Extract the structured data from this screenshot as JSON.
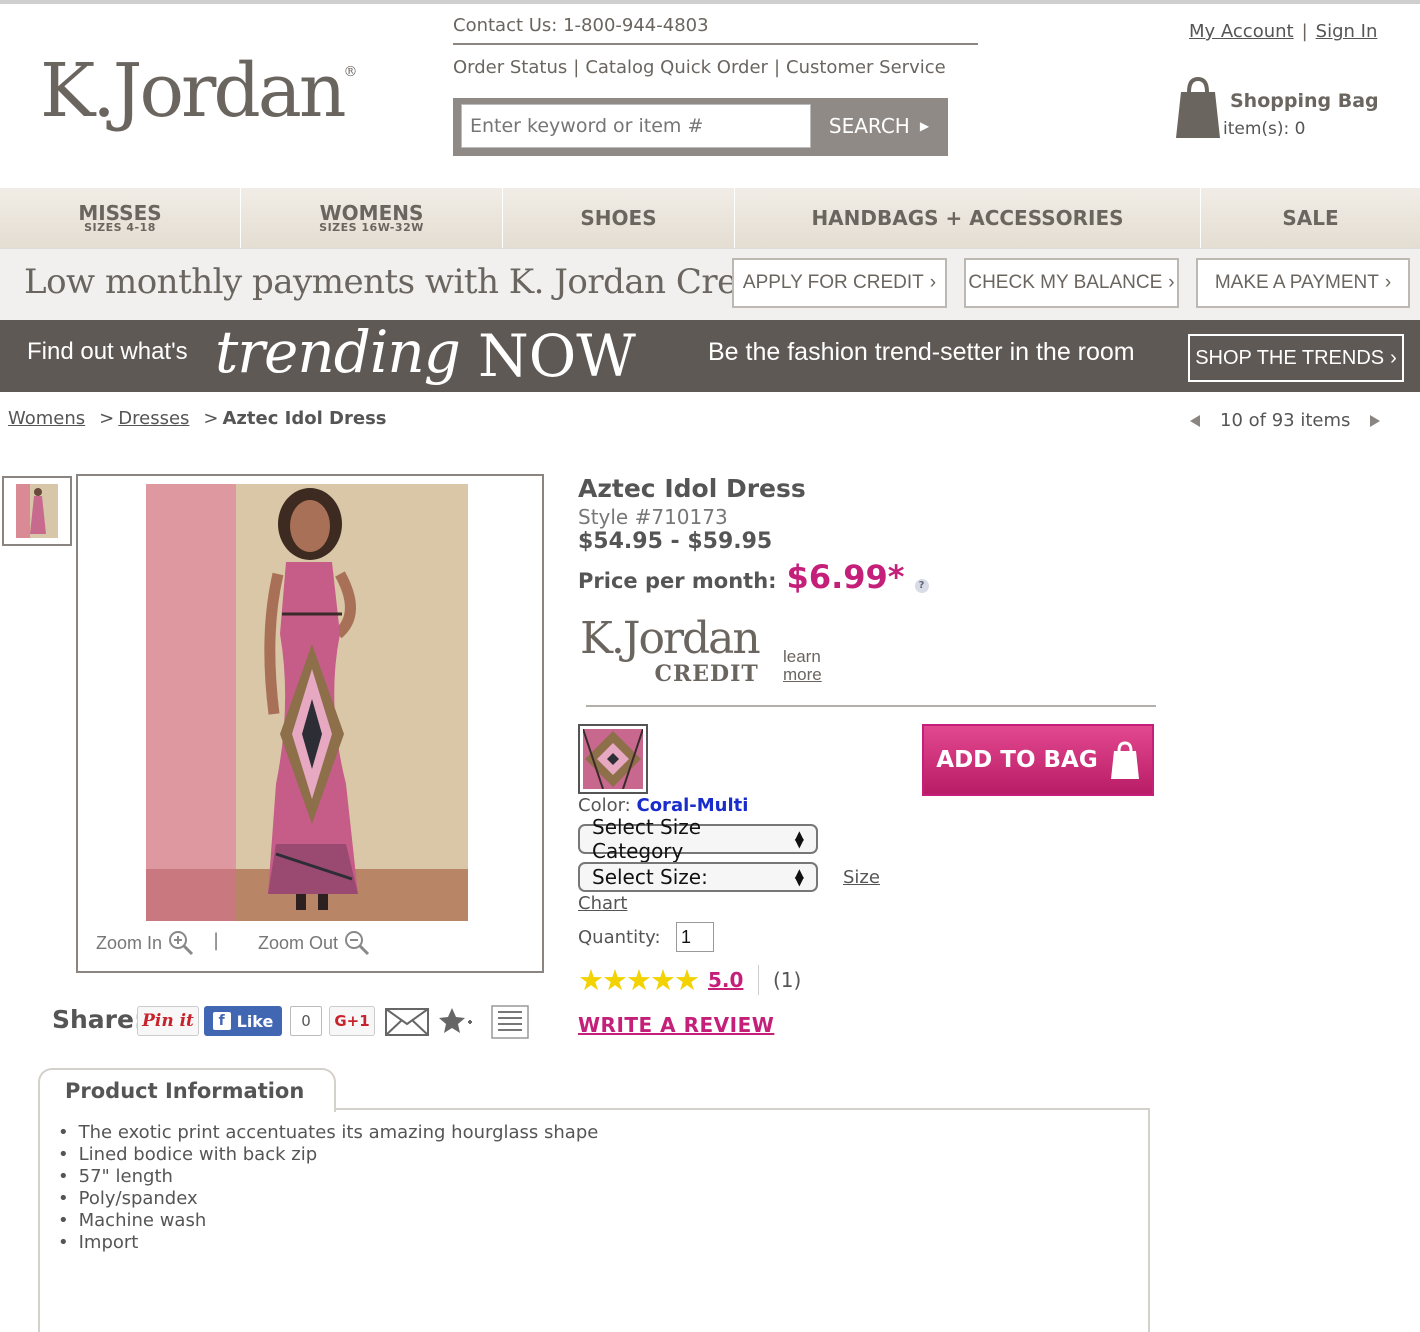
{
  "header": {
    "logo_text": "K.Jordan",
    "logo_mark": "®",
    "contact": "Contact Us: 1-800-944-4803",
    "links": [
      "Order Status",
      "Catalog Quick Order",
      "Customer Service"
    ],
    "search": {
      "placeholder": "Enter keyword or item #",
      "button": "SEARCH"
    },
    "account": {
      "my_account": "My Account",
      "sign_in": "Sign In"
    },
    "bag": {
      "title": "Shopping Bag",
      "count": "item(s): 0"
    }
  },
  "nav": [
    {
      "label": "MISSES",
      "sub": "SIZES 4-18"
    },
    {
      "label": "WOMENS",
      "sub": "SIZES 16W-32W"
    },
    {
      "label": "SHOES",
      "sub": ""
    },
    {
      "label": "HANDBAGS + ACCESSORIES",
      "sub": ""
    },
    {
      "label": "SALE",
      "sub": ""
    }
  ],
  "credit_bar": {
    "text": "Low monthly payments with K. Jordan Credit",
    "apply": "APPLY FOR CREDIT",
    "balance": "CHECK MY BALANCE",
    "payment": "MAKE A PAYMENT"
  },
  "trending": {
    "prefix": "Find out what's",
    "word": "trending",
    "now": "NOW",
    "tagline": "Be the fashion trend-setter in the room",
    "button": "SHOP THE TRENDS"
  },
  "breadcrumb": {
    "level1": "Womens",
    "level2": "Dresses",
    "current": "Aztec Idol Dress",
    "sep": ">"
  },
  "pager": "10 of 93 items",
  "gallery": {
    "zoom_in": "Zoom In",
    "zoom_out": "Zoom Out",
    "sep": "|"
  },
  "share": {
    "label": "Share:",
    "pin": "Pin it",
    "like": "Like",
    "like_count": "0",
    "gplus": "G+1"
  },
  "product": {
    "title": "Aztec Idol Dress",
    "style": "Style #710173",
    "price": "$54.95 - $59.95",
    "per_month_label": "Price per month:",
    "per_month": "$6.99*",
    "help": "?",
    "credit_logo": "K.Jordan",
    "credit_logo_sub": "CREDIT",
    "learn": "learn",
    "more": "more",
    "add_to_bag": "ADD TO BAG",
    "color_label": "Color:",
    "color_value": "Coral-Multi",
    "size_category": "Select Size Category",
    "size": "Select Size:",
    "size_chart_1": "Size",
    "size_chart_2": "Chart",
    "quantity_label": "Quantity:",
    "quantity": "1",
    "stars": "★★★★★",
    "rating": "5.0",
    "review_count": "(1)",
    "write_review": "WRITE A REVIEW"
  },
  "info": {
    "tab": "Product Information",
    "bullets": [
      "The exotic print accentuates its amazing hourglass shape",
      "Lined bodice with back zip",
      "57\" length",
      "Poly/spandex",
      "Machine wash",
      "Import"
    ]
  },
  "colors": {
    "accent": "#c4207a",
    "nav_bg": "#e9e3da",
    "band": "#5f5955",
    "link_blue": "#1a2dcc"
  }
}
